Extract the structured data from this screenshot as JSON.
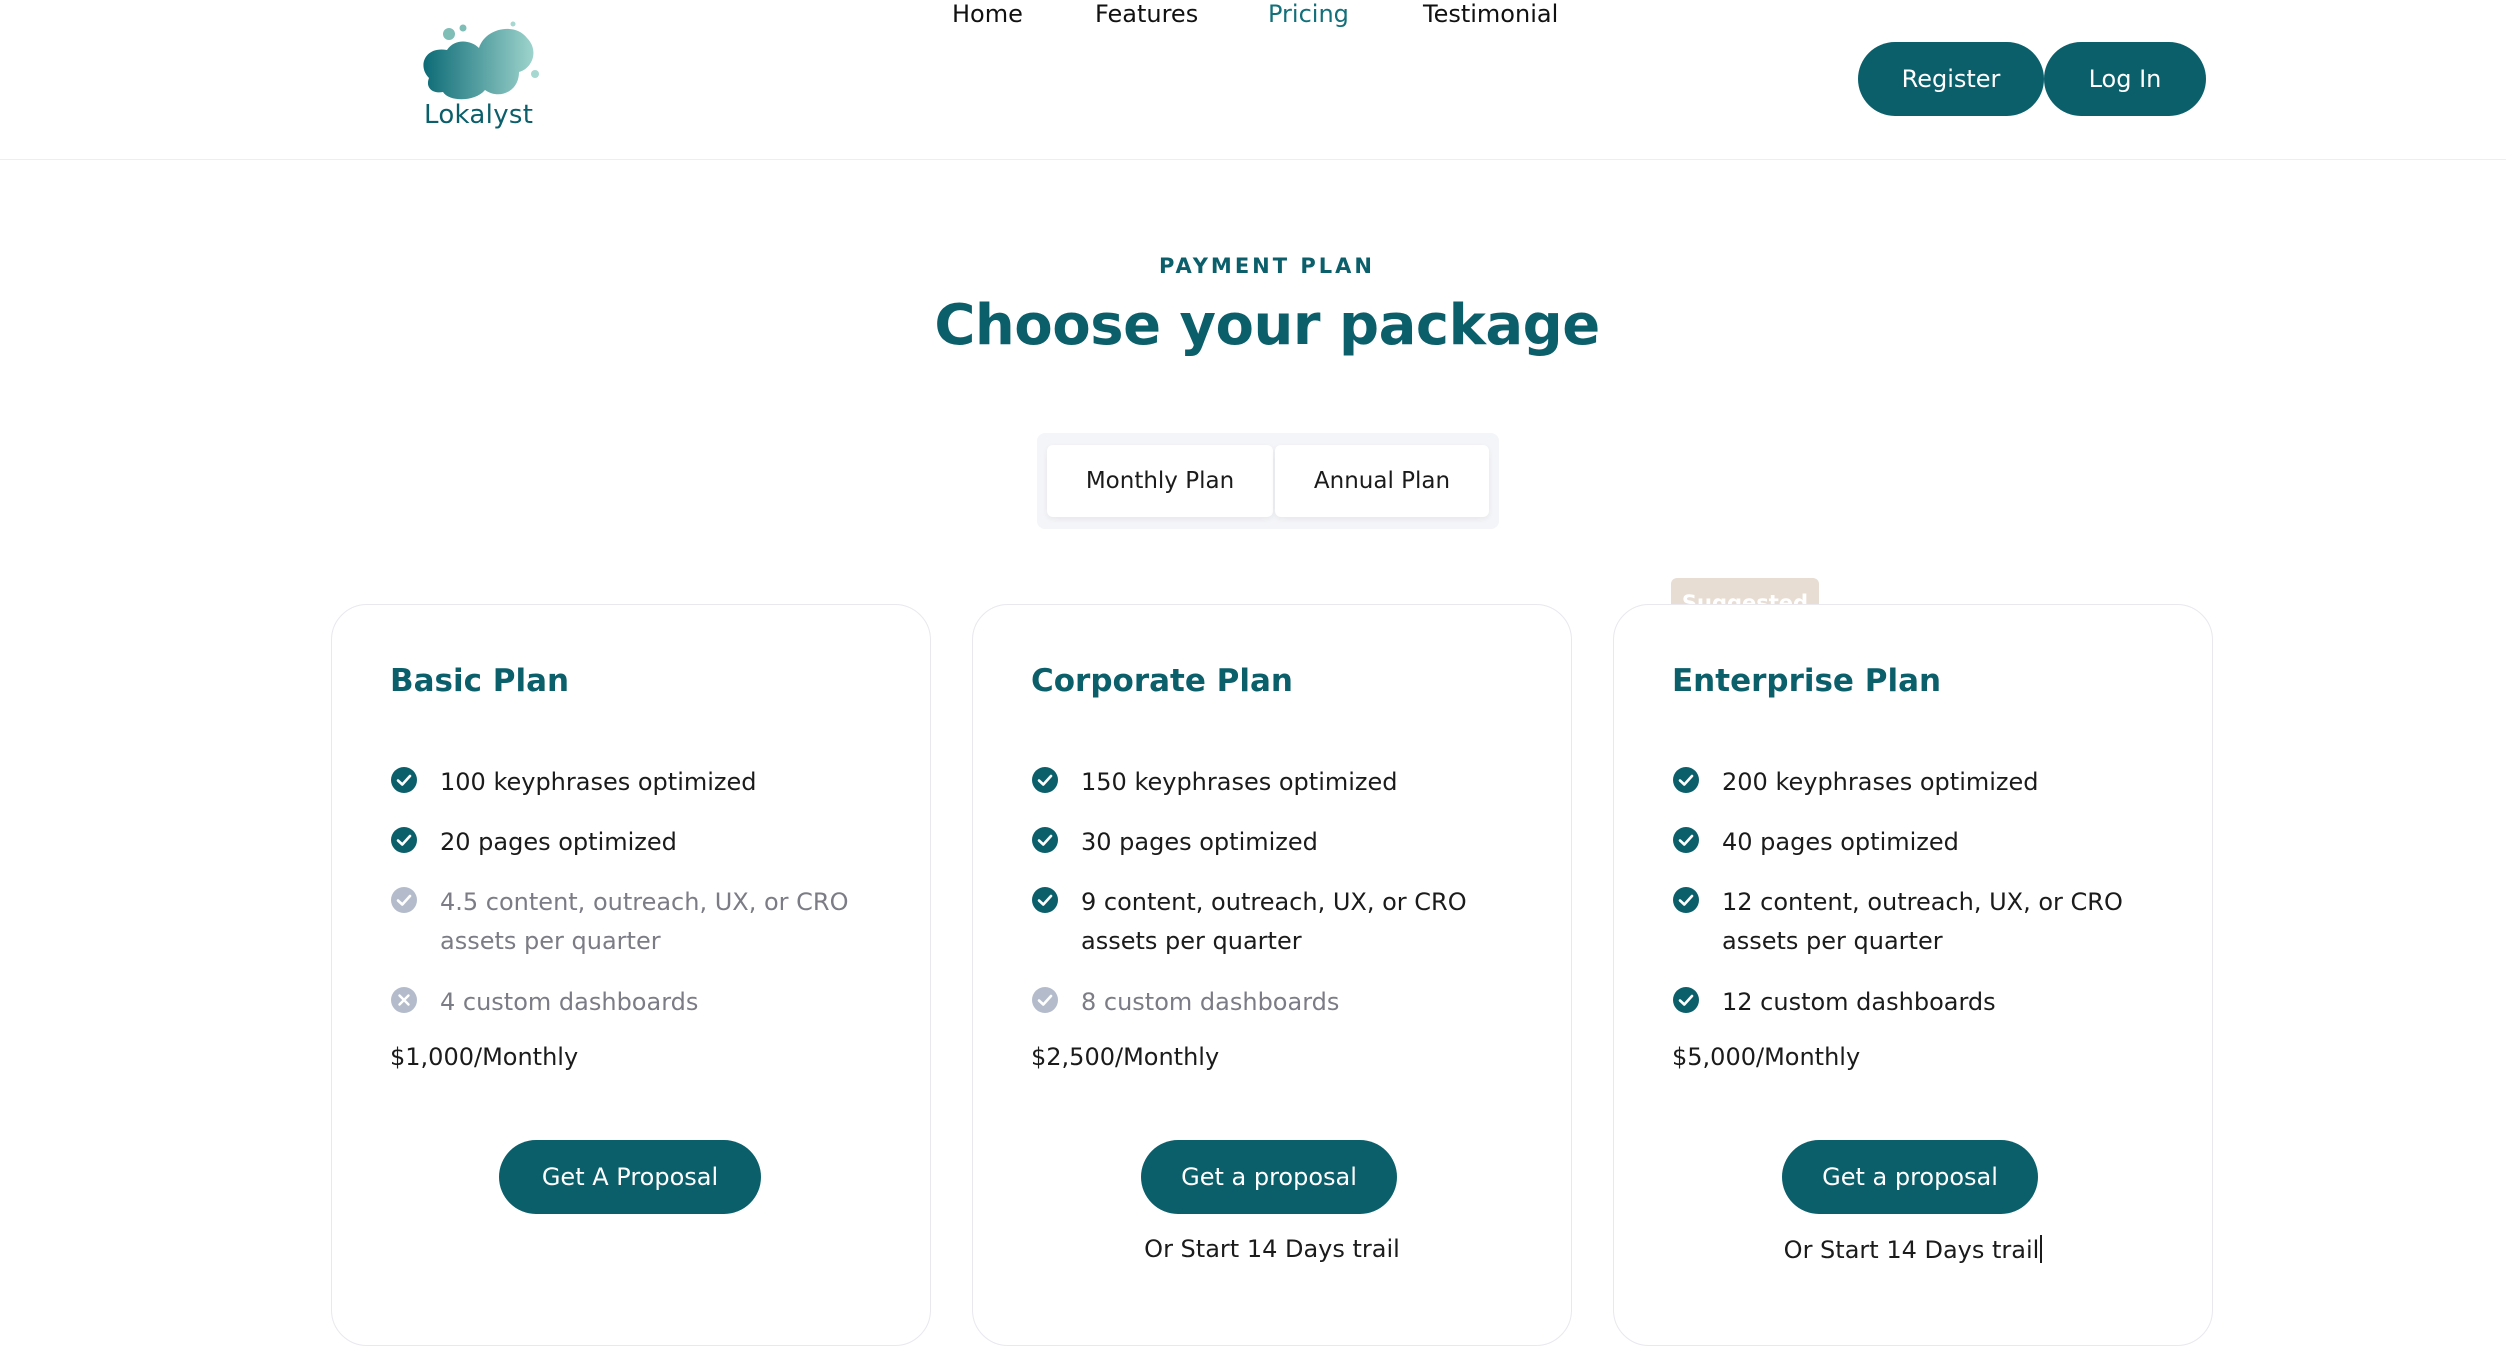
{
  "brand": {
    "name": "Lokalyst",
    "color": "#0b5f6b",
    "accent_light": "#8cc9c3"
  },
  "nav": {
    "items": [
      {
        "label": "Home",
        "active": false
      },
      {
        "label": "Features",
        "active": false
      },
      {
        "label": "Pricing",
        "active": true
      },
      {
        "label": "Testimonial",
        "active": false
      }
    ],
    "register_label": "Register",
    "login_label": "Log In"
  },
  "hero": {
    "eyebrow": "PAYMENT PLAN",
    "title": "Choose your package"
  },
  "plan_toggle": {
    "options": [
      "Monthly Plan",
      "Annual Plan"
    ],
    "selected": "Monthly Plan"
  },
  "plans": [
    {
      "name": "Basic Plan",
      "features": [
        {
          "text": "100 keyphrases optimized",
          "status": "included"
        },
        {
          "text": "20 pages optimized",
          "status": "included"
        },
        {
          "text": "4.5 content, outreach, UX, or CRO assets per quarter",
          "status": "partial"
        },
        {
          "text": "4 custom dashboards",
          "status": "excluded"
        }
      ],
      "price": "$1,000/Monthly",
      "cta_label": "Get A Proposal",
      "trial_text": ""
    },
    {
      "name": "Corporate Plan",
      "features": [
        {
          "text": "150 keyphrases optimized",
          "status": "included"
        },
        {
          "text": "30 pages optimized",
          "status": "included"
        },
        {
          "text": "9 content, outreach, UX, or CRO assets per quarter",
          "status": "included"
        },
        {
          "text": "8 custom dashboards",
          "status": "partial"
        }
      ],
      "price": "$2,500/Monthly",
      "cta_label": "Get a proposal",
      "trial_text": "Or Start 14 Days trail"
    },
    {
      "name": "Enterprise Plan",
      "badge": "Suggested",
      "features": [
        {
          "text": "200 keyphrases optimized",
          "status": "included"
        },
        {
          "text": "40 pages optimized",
          "status": "included"
        },
        {
          "text": "12 content, outreach, UX, or CRO assets per quarter",
          "status": "included"
        },
        {
          "text": "12 custom dashboards",
          "status": "included"
        }
      ],
      "price": "$5,000/Monthly",
      "cta_label": "Get a proposal",
      "trial_text": "Or Start 14 Days trail"
    }
  ],
  "colors": {
    "check_included": "#0b5f6b",
    "check_muted": "#b4bccb",
    "badge_bg": "#e8ddd3"
  }
}
